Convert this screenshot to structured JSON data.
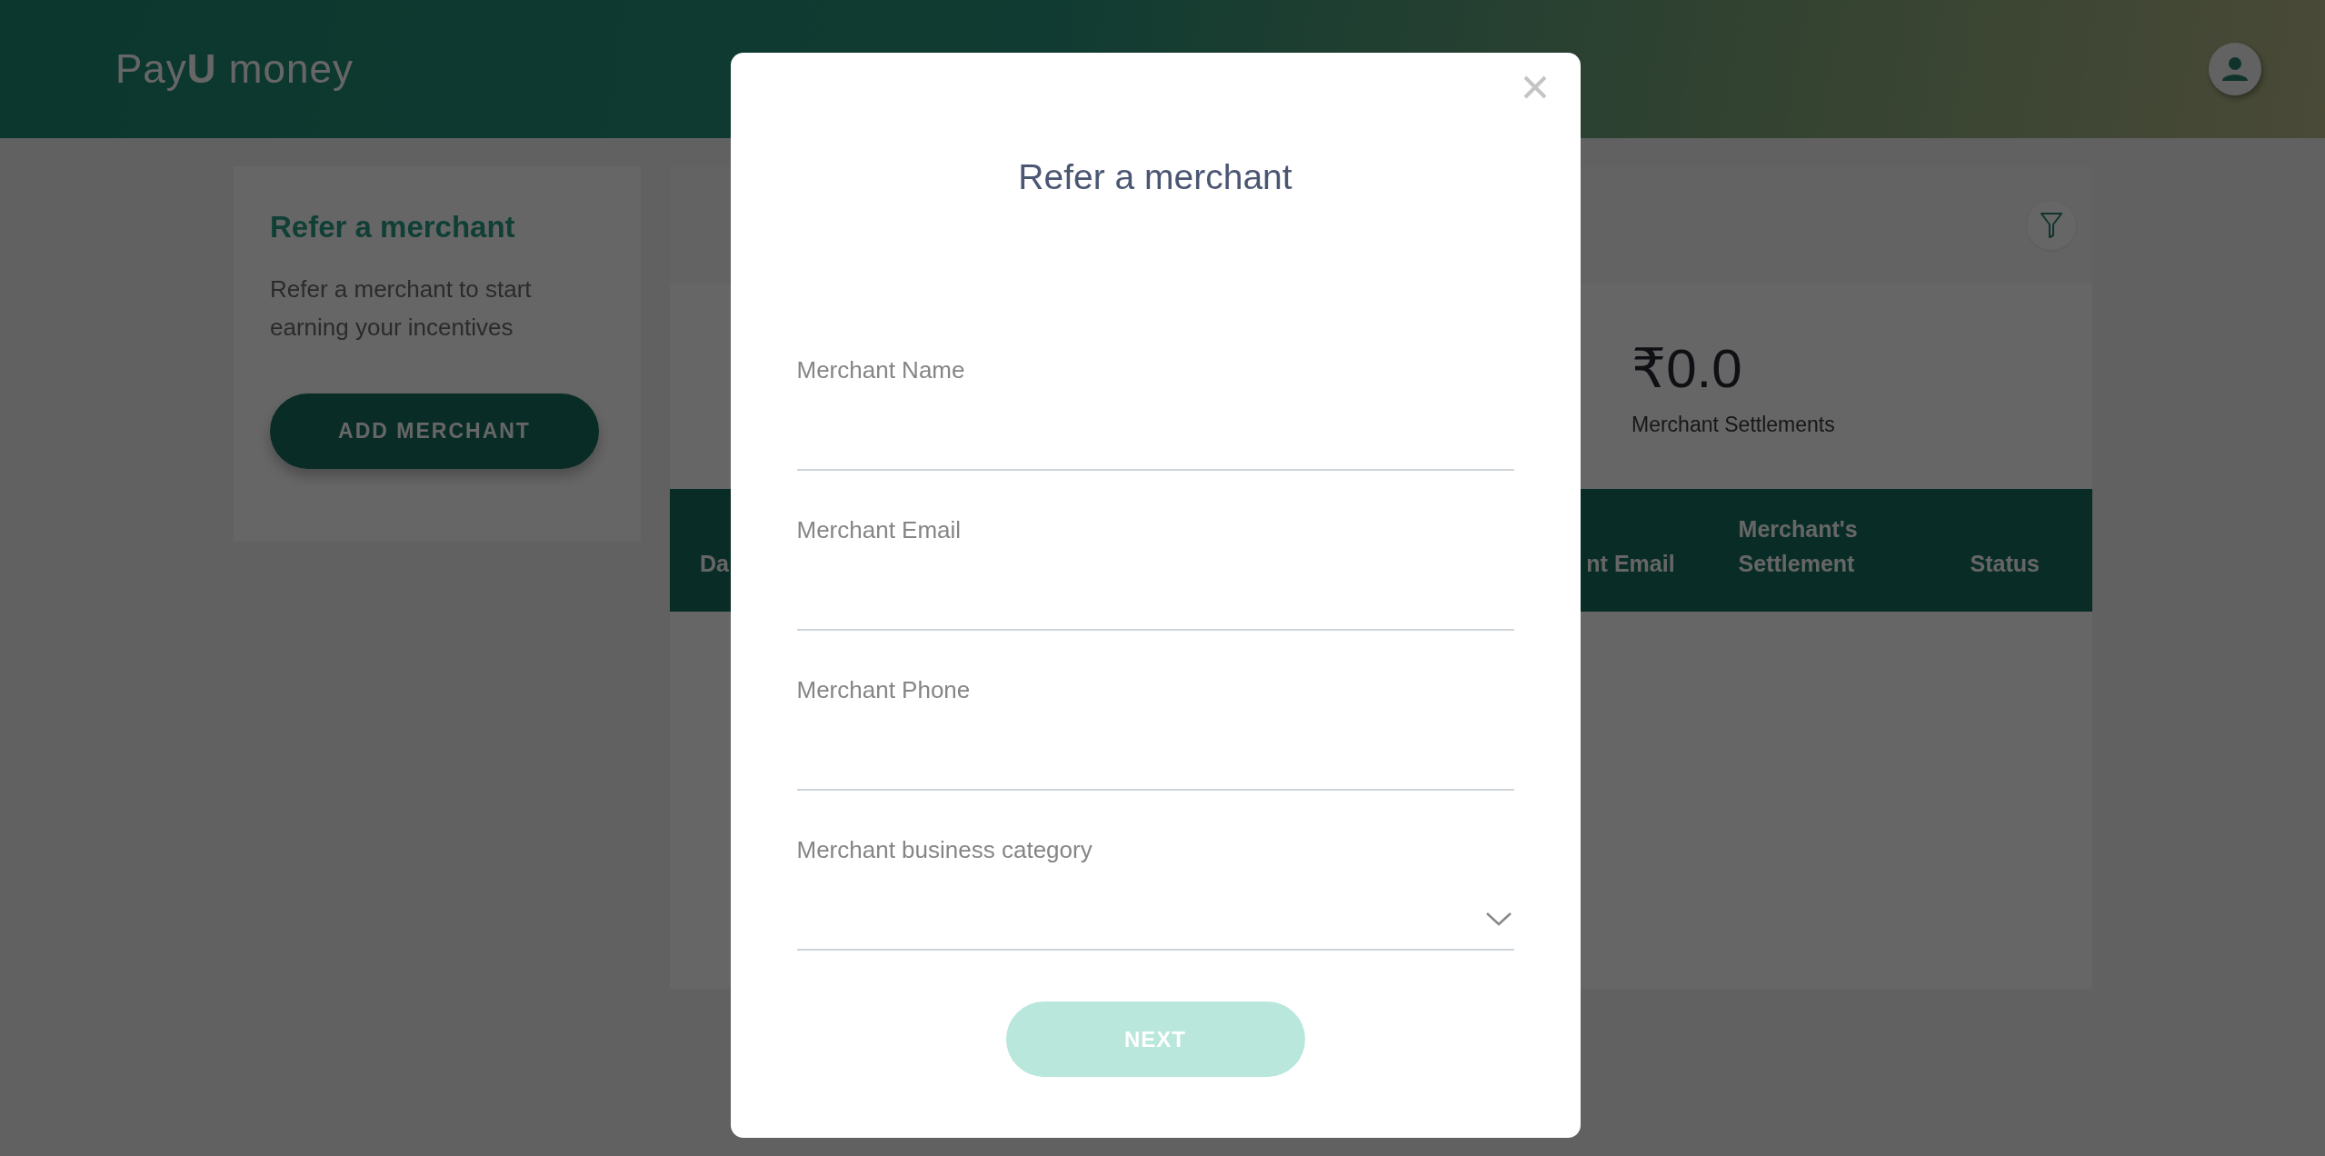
{
  "header": {
    "logo": "Pay**U** money"
  },
  "sidebar_card": {
    "title": "Refer a merchant",
    "text": "Refer a merchant to start earning your incentives",
    "button": "ADD MERCHANT"
  },
  "summary": {
    "amount": "₹0.0",
    "label": "Merchant Settlements"
  },
  "table": {
    "columns": [
      "Da",
      "nt Email",
      "Merchant's Settlement",
      "Status"
    ]
  },
  "modal": {
    "title": "Refer a merchant",
    "fields": [
      {
        "label": "Merchant Name",
        "kind": "text"
      },
      {
        "label": "Merchant Email",
        "kind": "text"
      },
      {
        "label": "Merchant Phone",
        "kind": "text"
      },
      {
        "label": "Merchant business category",
        "kind": "select"
      }
    ],
    "button": {
      "label": "NEXT",
      "disabled": true
    }
  }
}
